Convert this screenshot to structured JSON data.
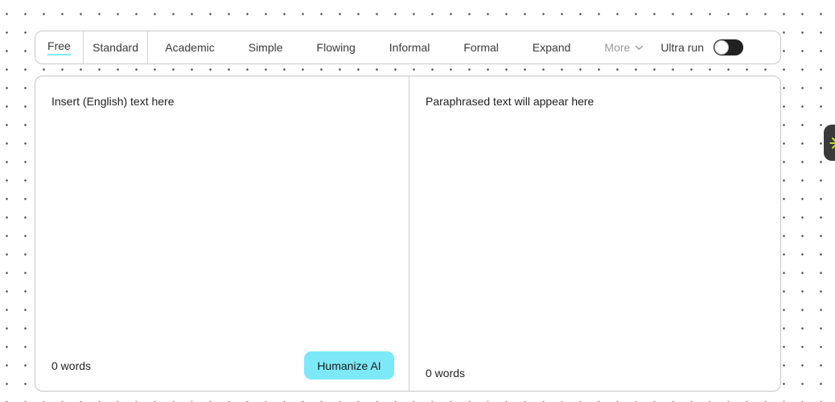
{
  "mode_bar": {
    "tabs": [
      {
        "label": "Free",
        "active": true
      },
      {
        "label": "Standard",
        "active": false
      },
      {
        "label": "Academic",
        "active": false
      },
      {
        "label": "Simple",
        "active": false
      },
      {
        "label": "Flowing",
        "active": false
      },
      {
        "label": "Informal",
        "active": false
      },
      {
        "label": "Formal",
        "active": false
      },
      {
        "label": "Expand",
        "active": false
      }
    ],
    "more_label": "More",
    "ultra_run_label": "Ultra run",
    "ultra_run_enabled": false
  },
  "editor": {
    "input_pane": {
      "placeholder": "Insert (English) text here",
      "word_count": "0 words"
    },
    "output_pane": {
      "placeholder": "Paraphrased text will appear here",
      "word_count": "0 words"
    },
    "humanize_button_label": "Humanize AI"
  },
  "side_button": {
    "icon": "starburst-icon"
  },
  "colors": {
    "accent_cyan": "#7de9f8",
    "toggle_track": "#212121",
    "side_button_bg": "#3a3a3a",
    "side_button_icon": "#c9df2b",
    "muted_text": "#9b9b9b"
  }
}
